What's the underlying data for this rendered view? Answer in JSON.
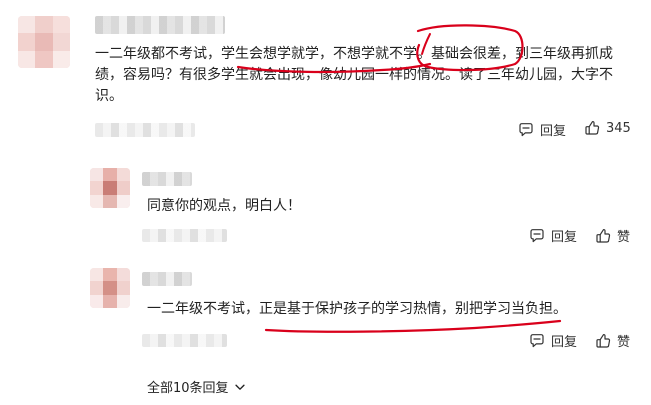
{
  "comments": [
    {
      "text_lines": [
        "一二年级都不考试，学生会想学就学，不想学就不学。基础会很差，到三年级再抓成",
        "绩，容易吗？有很多学生就会出现，像幼儿园一样的情况。读了三年幼儿园，大字不",
        "识。"
      ],
      "reply_label": "回复",
      "like_count": "345"
    }
  ],
  "replies": [
    {
      "text": "同意你的观点，明白人！",
      "reply_label": "回复",
      "like_label": "赞"
    },
    {
      "text": "一二年级不考试，正是基于保护孩子的学习热情，别把学习当负担。",
      "reply_label": "回复",
      "like_label": "赞"
    }
  ],
  "footer": {
    "expand_label": "全部10条回复"
  },
  "colors": {
    "annotation_red": "#d9001b",
    "text": "#222222",
    "muted": "#333333"
  },
  "icons": {
    "reply": "comment-bubble-icon",
    "like": "thumbs-up-icon",
    "expand": "chevron-down-icon"
  }
}
